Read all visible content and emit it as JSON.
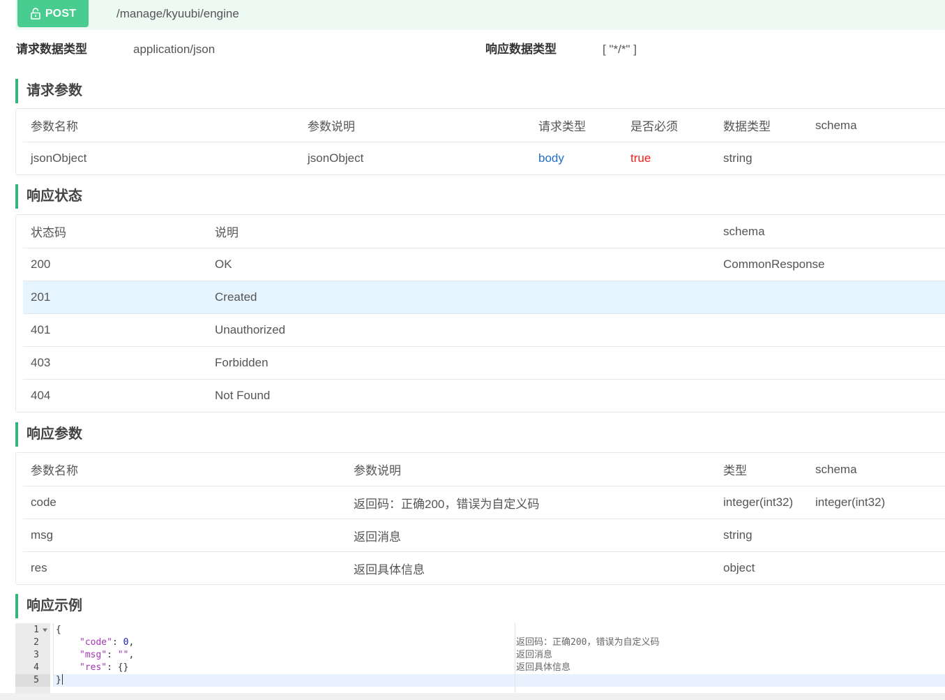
{
  "endpoint": {
    "method": "POST",
    "method_icon": "unlock-icon",
    "path": "/manage/kyuubi/engine"
  },
  "content_types": {
    "request_label": "请求数据类型",
    "request_value": "application/json",
    "response_label": "响应数据类型",
    "response_value": "[ \"*/*\" ]"
  },
  "request_params": {
    "title": "请求参数",
    "columns": [
      "参数名称",
      "参数说明",
      "请求类型",
      "是否必须",
      "数据类型",
      "schema"
    ],
    "rows": [
      {
        "name": "jsonObject",
        "description": "jsonObject",
        "in": "body",
        "required": "true",
        "type": "string"
      }
    ]
  },
  "response_status": {
    "title": "响应状态",
    "columns": [
      "状态码",
      "说明",
      "schema"
    ],
    "rows": [
      {
        "code": "200",
        "description": "OK",
        "schema": "CommonResponse"
      },
      {
        "code": "201",
        "description": "Created"
      },
      {
        "code": "401",
        "description": "Unauthorized"
      },
      {
        "code": "403",
        "description": "Forbidden"
      },
      {
        "code": "404",
        "description": "Not Found"
      }
    ]
  },
  "response_params": {
    "title": "响应参数",
    "columns": [
      "参数名称",
      "参数说明",
      "类型",
      "schema"
    ],
    "rows": [
      {
        "name": "code",
        "description": "返回码：正确200，错误为自定义码",
        "type": "integer(int32)",
        "schema": "integer(int32)"
      },
      {
        "name": "msg",
        "description": "返回消息",
        "type": "string"
      },
      {
        "name": "res",
        "description": "返回具体信息",
        "type": "object"
      }
    ]
  },
  "response_example": {
    "title": "响应示例",
    "fold_icon": "chevron-down-icon",
    "lines": [
      {
        "num": "1",
        "text": "{"
      },
      {
        "num": "2",
        "key": "\"code\"",
        "sep": ": ",
        "value": "0",
        "tail": ",",
        "comment": "返回码：正确200，错误为自定义码"
      },
      {
        "num": "3",
        "key": "\"msg\"",
        "sep": ": ",
        "value": "\"\"",
        "tail": ",",
        "comment": "返回消息"
      },
      {
        "num": "4",
        "key": "\"res\"",
        "sep": ": ",
        "value": "{}",
        "comment": "返回具体信息"
      },
      {
        "num": "5",
        "text": "}"
      }
    ]
  },
  "theme": {
    "method_post": "#49cc90",
    "topbar_bg": "#edf9f3",
    "section_accent": "#35b47c",
    "param_in": "#1f6fc5",
    "required": "#ff1a1a",
    "row_hover": "#e6f4ff",
    "code_key": "#a238b3",
    "code_number": "#1c1cbf",
    "active_line": "#e8f2ff"
  }
}
